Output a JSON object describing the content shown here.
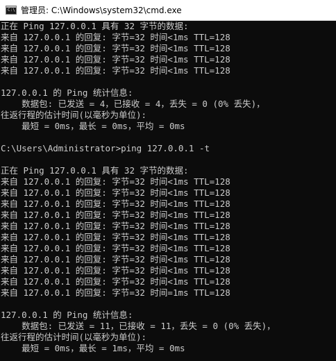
{
  "window": {
    "title": "管理员: C:\\Windows\\system32\\cmd.exe",
    "icon": "cmd-icon",
    "icon_label": "C:\\"
  },
  "colors": {
    "console_background": "#0c0c0c",
    "console_text": "#cccccc",
    "titlebar_background": "#ffffff"
  },
  "console": {
    "lines": [
      "正在 Ping 127.0.0.1 具有 32 字节的数据:",
      "来自 127.0.0.1 的回复: 字节=32 时间<1ms TTL=128",
      "来自 127.0.0.1 的回复: 字节=32 时间<1ms TTL=128",
      "来自 127.0.0.1 的回复: 字节=32 时间<1ms TTL=128",
      "来自 127.0.0.1 的回复: 字节=32 时间<1ms TTL=128",
      "",
      "127.0.0.1 的 Ping 统计信息:",
      "    数据包: 已发送 = 4，已接收 = 4，丢失 = 0 (0% 丢失)，",
      "往返行程的估计时间(以毫秒为单位):",
      "    最短 = 0ms，最长 = 0ms，平均 = 0ms",
      "",
      "C:\\Users\\Administrator>ping 127.0.0.1 -t",
      "",
      "正在 Ping 127.0.0.1 具有 32 字节的数据:",
      "来自 127.0.0.1 的回复: 字节=32 时间<1ms TTL=128",
      "来自 127.0.0.1 的回复: 字节=32 时间<1ms TTL=128",
      "来自 127.0.0.1 的回复: 字节=32 时间<1ms TTL=128",
      "来自 127.0.0.1 的回复: 字节=32 时间<1ms TTL=128",
      "来自 127.0.0.1 的回复: 字节=32 时间<1ms TTL=128",
      "来自 127.0.0.1 的回复: 字节=32 时间<1ms TTL=128",
      "来自 127.0.0.1 的回复: 字节=32 时间<1ms TTL=128",
      "来自 127.0.0.1 的回复: 字节=32 时间<1ms TTL=128",
      "来自 127.0.0.1 的回复: 字节=32 时间<1ms TTL=128",
      "来自 127.0.0.1 的回复: 字节=32 时间<1ms TTL=128",
      "来自 127.0.0.1 的回复: 字节=32 时间=1ms TTL=128",
      "",
      "127.0.0.1 的 Ping 统计信息:",
      "    数据包: 已发送 = 11，已接收 = 11，丢失 = 0 (0% 丢失)，",
      "往返行程的估计时间(以毫秒为单位):",
      "    最短 = 0ms，最长 = 1ms，平均 = 0ms"
    ]
  }
}
